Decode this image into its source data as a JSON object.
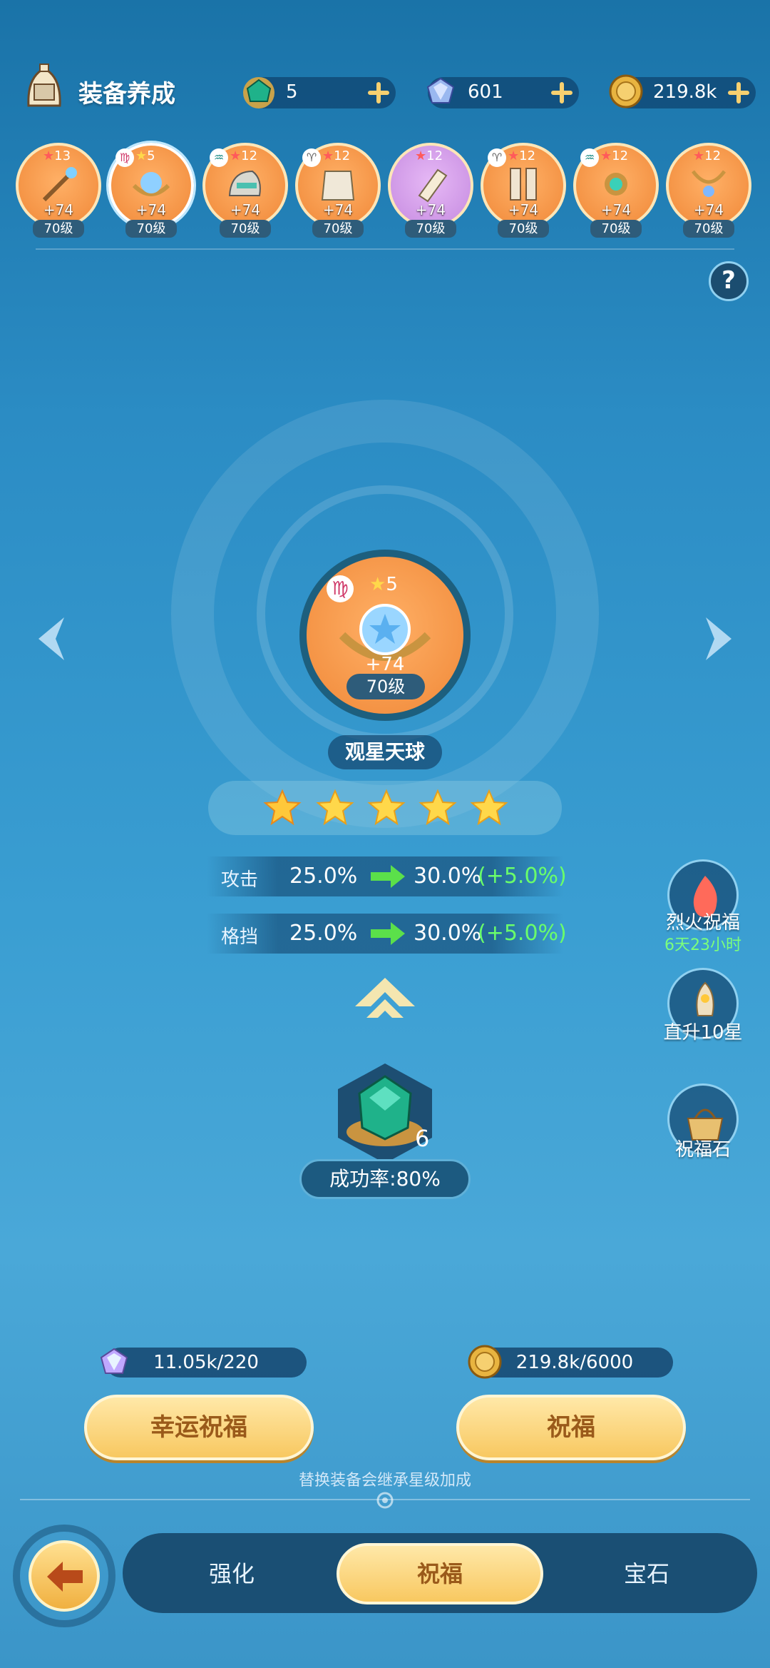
{
  "header": {
    "title": "装备养成",
    "currencies": [
      {
        "name": "green-gem",
        "value": "5"
      },
      {
        "name": "crystal",
        "value": "601"
      },
      {
        "name": "gold-coin",
        "value": "219.8k"
      }
    ]
  },
  "equipment": [
    {
      "stars": "13",
      "zodiac": "",
      "plus": "+74",
      "level": "70级",
      "color": "orange"
    },
    {
      "stars": "5",
      "zodiac": "♍",
      "plus": "+74",
      "level": "70级",
      "color": "orange",
      "selected": true
    },
    {
      "stars": "12",
      "zodiac": "♒",
      "plus": "+74",
      "level": "70级",
      "color": "orange"
    },
    {
      "stars": "12",
      "zodiac": "♈",
      "plus": "+74",
      "level": "70级",
      "color": "orange"
    },
    {
      "stars": "12",
      "zodiac": "",
      "plus": "+74",
      "level": "70级",
      "color": "purple"
    },
    {
      "stars": "12",
      "zodiac": "♈",
      "plus": "+74",
      "level": "70级",
      "color": "orange"
    },
    {
      "stars": "12",
      "zodiac": "♒",
      "plus": "+74",
      "level": "70级",
      "color": "orange"
    },
    {
      "stars": "12",
      "zodiac": "",
      "plus": "+74",
      "level": "70级",
      "color": "orange"
    }
  ],
  "help_label": "?",
  "item": {
    "zodiac": "♍",
    "stars": "5",
    "plus": "+74",
    "level": "70级",
    "name": "观星天球",
    "star_rating": 5,
    "star_rating_max": 5
  },
  "stats": [
    {
      "label": "攻击",
      "from": "25.0%",
      "to": "30.0%",
      "delta": "(+5.0%)"
    },
    {
      "label": "格挡",
      "from": "25.0%",
      "to": "30.0%",
      "delta": "(+5.0%)"
    }
  ],
  "stone": {
    "count": "6",
    "success_rate": "成功率:80%"
  },
  "side": {
    "fire_blessing": "烈火祝福",
    "fire_timer": "6天23小时",
    "rise10": "直升10星",
    "blessing_stone": "祝福石"
  },
  "costs": {
    "lucky": "11.05k/220",
    "bless": "219.8k/6000"
  },
  "buttons": {
    "lucky": "幸运祝福",
    "bless": "祝福"
  },
  "hint": "替换装备会继承星级加成",
  "nav": {
    "tab1": "强化",
    "tab2": "祝福",
    "tab3": "宝石"
  },
  "colors": {
    "accent": "#f8c860",
    "bg": "#2b8cc4",
    "green": "#6aff6a"
  }
}
